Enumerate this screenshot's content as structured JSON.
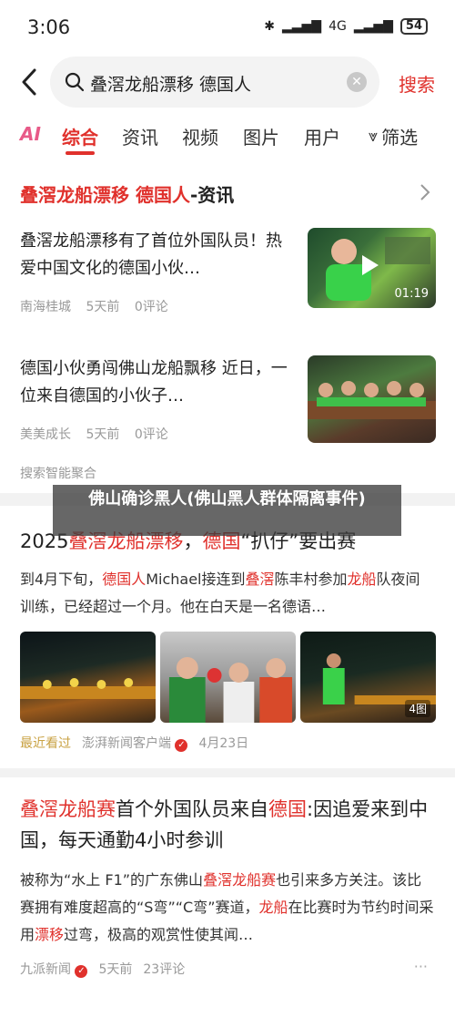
{
  "status_bar": {
    "time": "3:06",
    "network": "4G",
    "battery": "54"
  },
  "search": {
    "query": "叠滘龙船漂移  德国人",
    "button": "搜索"
  },
  "tabs": [
    {
      "label": "AI"
    },
    {
      "label": "综合"
    },
    {
      "label": "资讯"
    },
    {
      "label": "视频"
    },
    {
      "label": "图片"
    },
    {
      "label": "用户"
    },
    {
      "label": "筛选"
    }
  ],
  "news_section": {
    "title_highlight": "叠滘龙船漂移 德国人",
    "title_suffix": "-资讯",
    "items": [
      {
        "title": "叠滘龙船漂移有了首位外国队员！热爱中国文化的德国小伙…",
        "source": "南海桂城",
        "time": "5天前",
        "comments": "0评论",
        "duration": "01:19"
      },
      {
        "title": "德国小伙勇闯佛山龙船飘移 近日，一位来自德国的小伙子…",
        "source": "美美成长",
        "time": "5天前",
        "comments": "0评论"
      }
    ],
    "footer": "搜索智能聚合"
  },
  "banner": {
    "text": "佛山确诊黑人(佛山黑人群体隔离事件)"
  },
  "article1": {
    "title_parts": [
      "2025",
      "叠滘龙船漂移",
      "，",
      "德国",
      "“扒仔”要出赛"
    ],
    "summary_parts": [
      "到4月下旬，",
      "德国人",
      "Michael接连到",
      "叠滘",
      "陈丰村参加",
      "龙船",
      "队夜间训练，已经超过一个月。他在白天是一名德语…"
    ],
    "image_count": "4图",
    "recent": "最近看过",
    "source": "澎湃新闻客户端",
    "date": "4月23日"
  },
  "article2": {
    "title_parts": [
      "叠滘龙船赛",
      "首个外国队员来自",
      "德国",
      ":因追爱来到中国，每天通勤4小时参训"
    ],
    "summary_parts": [
      "被称为“水上 F1”的广东佛山",
      "叠滘龙船赛",
      "也引来多方关注。该比赛拥有难度超高的“S弯”“C弯”赛道，",
      "龙船",
      "在比赛时为节约时间采用",
      "漂移",
      "过弯，极高的观赏性使其闻…"
    ],
    "source": "九派新闻",
    "time": "5天前",
    "comments": "23评论",
    "more": "···"
  },
  "colors": {
    "accent": "#e0312c",
    "ai": "#e85a88",
    "muted": "#999999"
  }
}
